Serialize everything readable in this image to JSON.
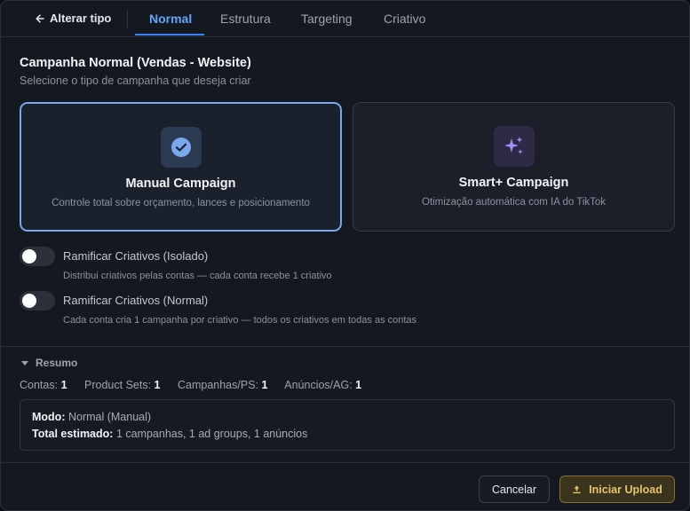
{
  "tabs": {
    "back_label": "Alterar tipo",
    "items": [
      {
        "label": "Normal"
      },
      {
        "label": "Estrutura"
      },
      {
        "label": "Targeting"
      },
      {
        "label": "Criativo"
      }
    ]
  },
  "campaign": {
    "title": "Campanha Normal (Vendas - Website)",
    "subtitle": "Selecione o tipo de campanha que deseja criar"
  },
  "cards": {
    "manual": {
      "title": "Manual Campaign",
      "description": "Controle total sobre orçamento, lances e posicionamento",
      "icon": "check-circle-icon"
    },
    "smart": {
      "title": "Smart+ Campaign",
      "description": "Otimização automática com IA do TikTok",
      "icon": "sparkles-icon"
    }
  },
  "toggles": {
    "isolado": {
      "label": "Ramificar Criativos (Isolado)",
      "description": "Distribui criativos pelas contas — cada conta recebe 1 criativo"
    },
    "normal": {
      "label": "Ramificar Criativos (Normal)",
      "description": "Cada conta cria 1 campanha por criativo — todos os criativos em todas as contas"
    }
  },
  "summary": {
    "header": "Resumo",
    "stats": [
      {
        "label": "Contas:",
        "value": "1"
      },
      {
        "label": "Product Sets:",
        "value": "1"
      },
      {
        "label": "Campanhas/PS:",
        "value": "1"
      },
      {
        "label": "Anúncios/AG:",
        "value": "1"
      }
    ],
    "mode_label": "Modo:",
    "mode_value": "Normal (Manual)",
    "total_label": "Total estimado:",
    "total_value": "1 campanhas, 1 ad groups, 1 anúncios"
  },
  "footer": {
    "cancel_label": "Cancelar",
    "upload_label": "Iniciar Upload"
  },
  "colors": {
    "accent": "#3b82f6",
    "upload": "#e7c46a",
    "smart_icon": "#a78bfa"
  }
}
